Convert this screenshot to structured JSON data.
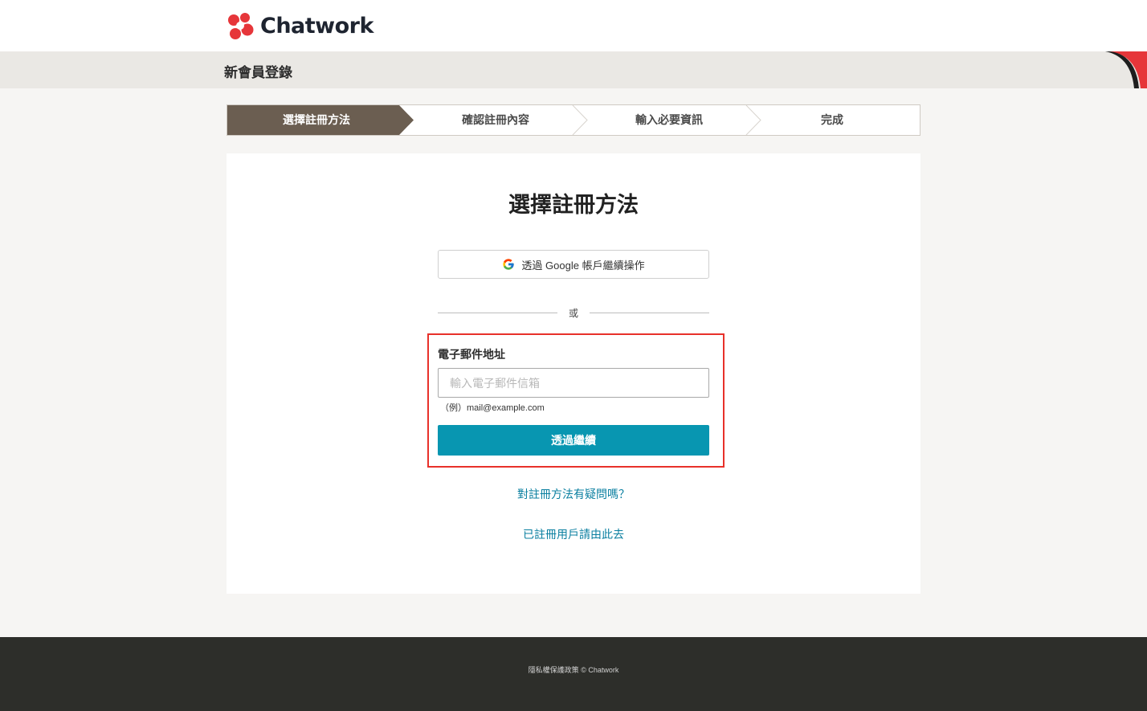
{
  "header": {
    "logo_text": "Chatwork",
    "logo_colors": [
      "#e6363a",
      "#e6363a",
      "#e6363a",
      "#e6363a"
    ],
    "page_title": "新會員登錄"
  },
  "steps": {
    "items": [
      {
        "label": "選擇註冊方法",
        "active": true
      },
      {
        "label": "確認註冊內容",
        "active": false
      },
      {
        "label": "輸入必要資訊",
        "active": false
      },
      {
        "label": "完成",
        "active": false
      }
    ],
    "active_color": "#6b5e51"
  },
  "card": {
    "title": "選擇註冊方法",
    "google_button_label": "透過 Google 帳戶繼續操作",
    "divider_text": "或",
    "email_label": "電子郵件地址",
    "email_placeholder": "輸入電子郵件信箱",
    "email_value": "",
    "example_text": "（例）mail@example.com",
    "continue_label": "透過繼續",
    "continue_color": "#0896b1",
    "help_link": "對註冊方法有疑問嗎？",
    "login_link": "已註冊用戶請由此去"
  },
  "footer": {
    "privacy_link": "隱私權保護政策",
    "copyright": "© Chatwork"
  }
}
